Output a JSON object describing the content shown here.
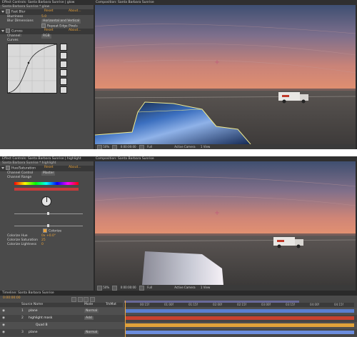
{
  "top": {
    "effects_header": "Effect Controls: Santa Barbara Sunrise | glow",
    "layer_title": "Santa Barbara Sunrise * glow",
    "effect_name": "Fast Blur",
    "effect_reset": "Reset",
    "effect_about": "About...",
    "blurriness_label": "Blurriness",
    "blurriness_value": "5.0",
    "blur_dimensions_label": "Blur Dimensions",
    "blur_dimensions_value": "Horizontal and Vertical",
    "repeat_edge_label": "Repeat Edge Pixels",
    "curves_name": "Curves",
    "curves_reset": "Reset",
    "curves_about": "About...",
    "channel_label": "Channel:",
    "channel_value": "RGB",
    "curves_label": "Curves",
    "comp_header": "Composition: Santa Barbara Sunrise",
    "zoom": "50%",
    "timecode": "0:00:00:00",
    "resolution": "Full",
    "camera": "Active Camera",
    "views": "1 View"
  },
  "bottom": {
    "effects_header": "Effect Controls: Santa Barbara Sunrise | highlight",
    "layer_title": "Santa Barbara Sunrise * highlight",
    "effect_name": "Hue/Saturation",
    "effect_reset": "Reset",
    "effect_about": "About...",
    "channel_control_label": "Channel Control",
    "channel_control_value": "Master",
    "channel_range_label": "Channel Range",
    "colorize_label": "Colorize",
    "colorize_hue_label": "Colorize Hue",
    "colorize_hue_value": "0x +0.0°",
    "colorize_saturation_label": "Colorize Saturation",
    "colorize_saturation_value": "25",
    "colorize_lightness_label": "Colorize Lightness",
    "colorize_lightness_value": "0",
    "comp_header": "Composition: Santa Barbara Sunrise",
    "zoom": "50%",
    "timecode": "0:00:00:00",
    "resolution": "Full",
    "camera": "Active Camera",
    "views": "1 View"
  },
  "timeline": {
    "header": "Timeline: Santa Barbara Sunrise",
    "timecode": "0:00:00:00",
    "col_source": "Source Name",
    "col_mode": "Mode",
    "col_trkmat": "TrkMat",
    "layers": [
      {
        "num": "1",
        "name": "plane",
        "mode": "Normal"
      },
      {
        "num": "2",
        "name": "highlight mask",
        "mode": "Add"
      },
      {
        "num": "",
        "name": "Quad B",
        "mode": ""
      },
      {
        "num": "3",
        "name": "plane",
        "mode": "Normal"
      }
    ],
    "ruler": [
      "00:15f",
      "01:00f",
      "01:15f",
      "02:00f",
      "02:15f",
      "03:00f",
      "03:15f",
      "04:00f",
      "04:15f"
    ],
    "bar_colors": [
      "#5a7fd0",
      "#c8412e",
      "#e0a23a",
      "#6b8cdc"
    ]
  },
  "colors": {
    "panel": "#4a4a4a",
    "accent": "#e8a23a",
    "sky_top": "#3e4f72",
    "sky_horizon": "#e08a74"
  }
}
